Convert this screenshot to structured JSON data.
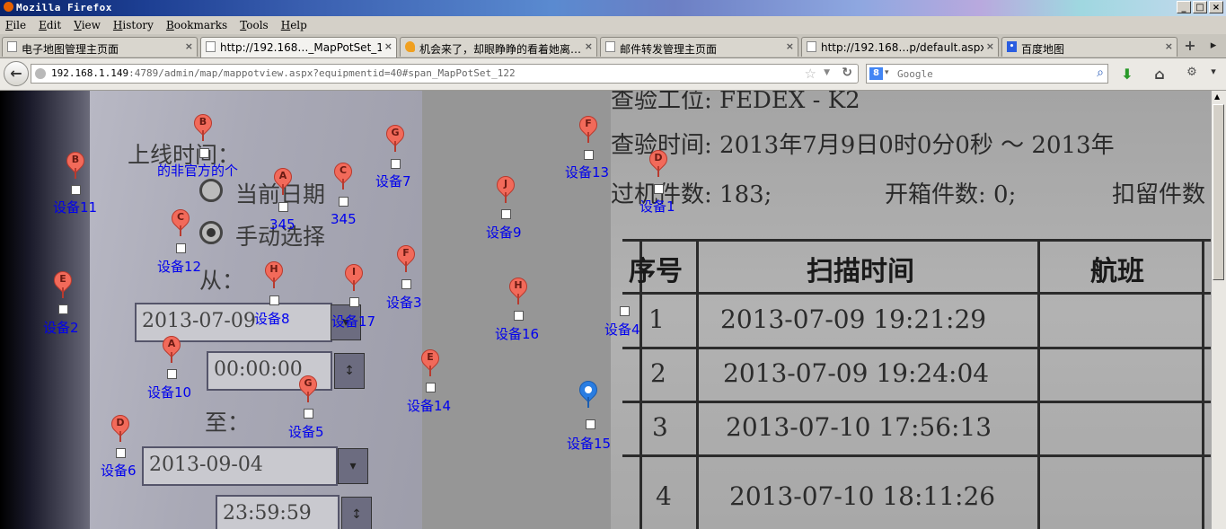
{
  "window": {
    "title": "Mozilla Firefox",
    "controls": [
      "_",
      "□",
      "×"
    ]
  },
  "menu": [
    "File",
    "Edit",
    "View",
    "History",
    "Bookmarks",
    "Tools",
    "Help"
  ],
  "tabs": [
    {
      "label": "电子地图管理主页面",
      "icon": "page-icon",
      "active": false
    },
    {
      "label": "http://192.168…_MapPotSet_122",
      "icon": "page-icon",
      "active": true
    },
    {
      "label": "机会来了，却眼睁睁的看着她离…",
      "icon": "warning-icon",
      "active": false
    },
    {
      "label": "邮件转发管理主页面",
      "icon": "page-icon",
      "active": false
    },
    {
      "label": "http://192.168…p/default.aspx",
      "icon": "page-icon",
      "active": false
    },
    {
      "label": "百度地图",
      "icon": "baidu-icon",
      "active": false
    }
  ],
  "tab_close": "×",
  "new_tab": "+",
  "nav": {
    "url_host": "192.168.1.149",
    "url_rest": ":4789/admin/map/mappotview.aspx?equipmentid=40#span_MapPotSet_122",
    "search_placeholder": "Google",
    "search_engine_letter": "8"
  },
  "photo": {
    "left_labels": {
      "online_time": "上线时间：",
      "current_date": "当前日期",
      "manual_select": "手动选择",
      "from": "从：",
      "to": "至："
    },
    "fields": {
      "from_date": "2013-07-09",
      "from_time": "00:00:00",
      "to_date": "2013-09-04",
      "to_time": "23:59:59"
    },
    "header_line1": "查验工位: FEDEX - K2",
    "header_line2": "查验时间: 2013年7月9日0时0分0秒 ～ 2013年",
    "header_line3": "过机件数: 183;",
    "header_line3b": "开箱件数: 0;",
    "header_line3c": "扣留件数",
    "table_headers": [
      "序号",
      "扫描时间",
      "航班"
    ],
    "rows": [
      {
        "no": "1",
        "time": "2013-07-09 19:21:29"
      },
      {
        "no": "2",
        "time": "2013-07-09 19:24:04"
      },
      {
        "no": "3",
        "time": "2013-07-10 17:56:13"
      },
      {
        "no": "4",
        "time": "2013-07-10 18:11:26"
      }
    ]
  },
  "markers": [
    {
      "letter": "B",
      "label": "的非官方的个",
      "color": "#f26a5a"
    },
    {
      "letter": "B",
      "label": "设备11",
      "color": "#f26a5a"
    },
    {
      "letter": "G",
      "label": "设备7",
      "color": "#f26a5a"
    },
    {
      "letter": "F",
      "label": "设备13",
      "color": "#f26a5a"
    },
    {
      "letter": "D",
      "label": "设备1",
      "color": "#f26a5a"
    },
    {
      "letter": "A",
      "label": "345",
      "color": "#f26a5a"
    },
    {
      "letter": "C",
      "label": "345",
      "color": "#f26a5a"
    },
    {
      "letter": "J",
      "label": "设备9",
      "color": "#f26a5a"
    },
    {
      "letter": "C",
      "label": "设备12",
      "color": "#f26a5a"
    },
    {
      "letter": "E",
      "label": "设备2",
      "color": "#f26a5a"
    },
    {
      "letter": "H",
      "label": "设备8",
      "color": "#f26a5a"
    },
    {
      "letter": "I",
      "label": "设备17",
      "color": "#f26a5a"
    },
    {
      "letter": "F",
      "label": "设备3",
      "color": "#f26a5a"
    },
    {
      "letter": "H",
      "label": "设备16",
      "color": "#f26a5a"
    },
    {
      "letter": "",
      "label": "设备4",
      "color": "#f26a5a"
    },
    {
      "letter": "A",
      "label": "设备10",
      "color": "#f26a5a"
    },
    {
      "letter": "E",
      "label": "设备14",
      "color": "#f26a5a"
    },
    {
      "letter": "G",
      "label": "设备5",
      "color": "#f26a5a"
    },
    {
      "letter": "",
      "label": "设备15",
      "color": "#2a7de1"
    },
    {
      "letter": "D",
      "label": "设备6",
      "color": "#f26a5a"
    }
  ]
}
